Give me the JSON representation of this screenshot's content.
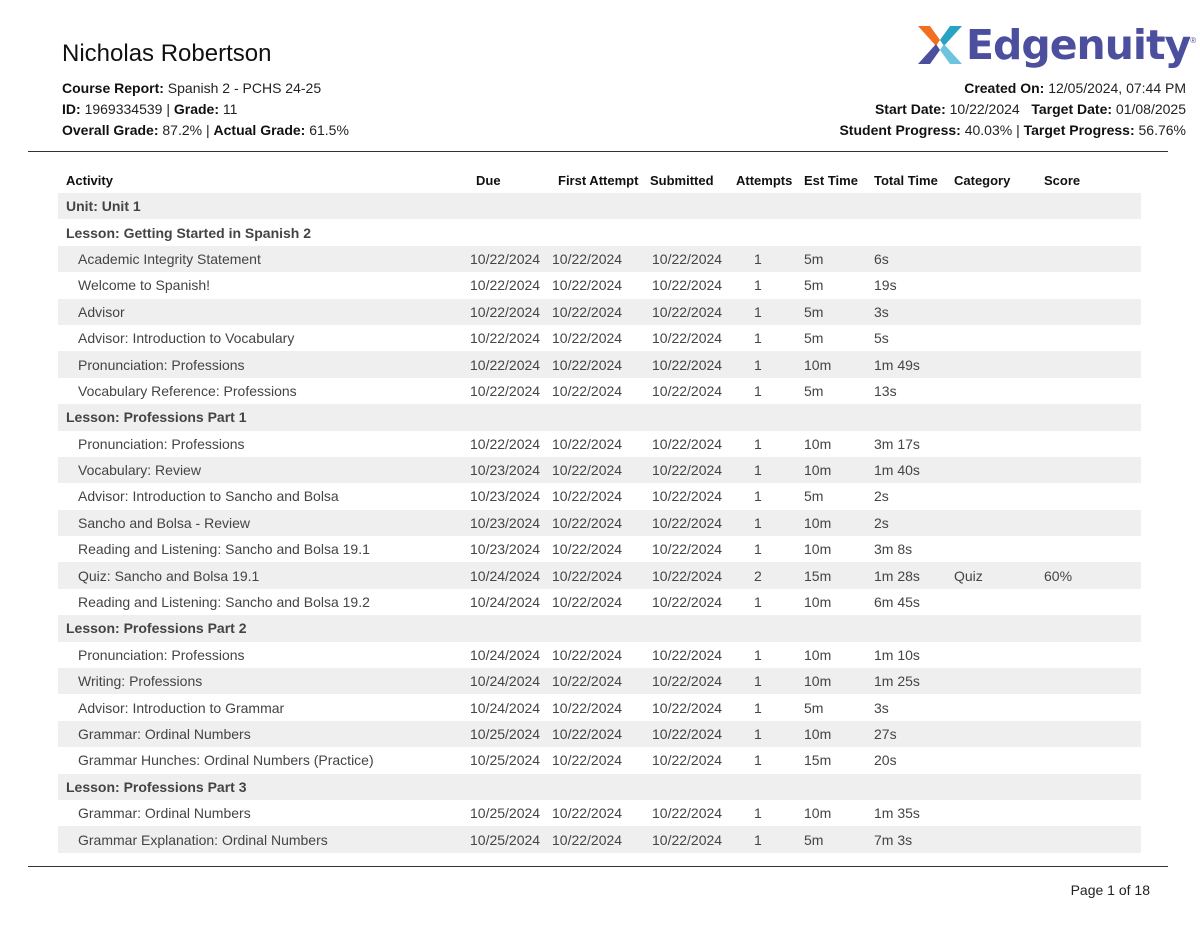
{
  "header": {
    "student_name": "Nicholas Robertson",
    "course_report_label": "Course Report:",
    "course_report_value": "Spanish 2 - PCHS 24-25",
    "id_label": "ID:",
    "id_value": "1969334539",
    "grade_label": "Grade:",
    "grade_value": "11",
    "overall_grade_label": "Overall Grade:",
    "overall_grade_value": "87.2%",
    "actual_grade_label": "Actual Grade:",
    "actual_grade_value": "61.5%",
    "created_on_label": "Created On:",
    "created_on_value": "12/05/2024, 07:44 PM",
    "start_date_label": "Start Date:",
    "start_date_value": "10/22/2024",
    "target_date_label": "Target Date:",
    "target_date_value": "01/08/2025",
    "student_progress_label": "Student Progress:",
    "student_progress_value": "40.03%",
    "target_progress_label": "Target Progress:",
    "target_progress_value": "56.76%",
    "separator": "|"
  },
  "logo": {
    "text": "Edgenuity",
    "reg": "®",
    "colors": {
      "purple": "#4b4f9e",
      "orange": "#f26f21",
      "teal": "#29a3c2",
      "light_blue": "#6cc4de"
    }
  },
  "table": {
    "columns": [
      "Activity",
      "Due",
      "First Attempt",
      "Submitted",
      "Attempts",
      "Est Time",
      "Total Time",
      "Category",
      "Score"
    ],
    "rows": [
      {
        "type": "group",
        "label": "Unit: Unit 1"
      },
      {
        "type": "group",
        "label": "Lesson: Getting Started in Spanish 2"
      },
      {
        "type": "item",
        "cells": [
          "Academic Integrity Statement",
          "10/22/2024",
          "10/22/2024",
          "10/22/2024",
          "1",
          "5m",
          "6s",
          "",
          ""
        ]
      },
      {
        "type": "item",
        "cells": [
          "Welcome to Spanish!",
          "10/22/2024",
          "10/22/2024",
          "10/22/2024",
          "1",
          "5m",
          "19s",
          "",
          ""
        ]
      },
      {
        "type": "item",
        "cells": [
          "Advisor",
          "10/22/2024",
          "10/22/2024",
          "10/22/2024",
          "1",
          "5m",
          "3s",
          "",
          ""
        ]
      },
      {
        "type": "item",
        "cells": [
          "Advisor: Introduction to Vocabulary",
          "10/22/2024",
          "10/22/2024",
          "10/22/2024",
          "1",
          "5m",
          "5s",
          "",
          ""
        ]
      },
      {
        "type": "item",
        "cells": [
          "Pronunciation: Professions",
          "10/22/2024",
          "10/22/2024",
          "10/22/2024",
          "1",
          "10m",
          "1m 49s",
          "",
          ""
        ]
      },
      {
        "type": "item",
        "cells": [
          "Vocabulary Reference: Professions",
          "10/22/2024",
          "10/22/2024",
          "10/22/2024",
          "1",
          "5m",
          "13s",
          "",
          ""
        ]
      },
      {
        "type": "group",
        "label": "Lesson: Professions Part 1"
      },
      {
        "type": "item",
        "cells": [
          "Pronunciation: Professions",
          "10/22/2024",
          "10/22/2024",
          "10/22/2024",
          "1",
          "10m",
          "3m 17s",
          "",
          ""
        ]
      },
      {
        "type": "item",
        "cells": [
          "Vocabulary: Review",
          "10/23/2024",
          "10/22/2024",
          "10/22/2024",
          "1",
          "10m",
          "1m 40s",
          "",
          ""
        ]
      },
      {
        "type": "item",
        "cells": [
          "Advisor: Introduction to Sancho and Bolsa",
          "10/23/2024",
          "10/22/2024",
          "10/22/2024",
          "1",
          "5m",
          "2s",
          "",
          ""
        ]
      },
      {
        "type": "item",
        "cells": [
          "Sancho and Bolsa - Review",
          "10/23/2024",
          "10/22/2024",
          "10/22/2024",
          "1",
          "10m",
          "2s",
          "",
          ""
        ]
      },
      {
        "type": "item",
        "cells": [
          "Reading and Listening: Sancho and Bolsa 19.1",
          "10/23/2024",
          "10/22/2024",
          "10/22/2024",
          "1",
          "10m",
          "3m 8s",
          "",
          ""
        ]
      },
      {
        "type": "item",
        "cells": [
          "Quiz: Sancho and Bolsa 19.1",
          "10/24/2024",
          "10/22/2024",
          "10/22/2024",
          "2",
          "15m",
          "1m 28s",
          "Quiz",
          "60%"
        ]
      },
      {
        "type": "item",
        "cells": [
          "Reading and Listening: Sancho and Bolsa 19.2",
          "10/24/2024",
          "10/22/2024",
          "10/22/2024",
          "1",
          "10m",
          "6m 45s",
          "",
          ""
        ]
      },
      {
        "type": "group",
        "label": "Lesson: Professions Part 2"
      },
      {
        "type": "item",
        "cells": [
          "Pronunciation: Professions",
          "10/24/2024",
          "10/22/2024",
          "10/22/2024",
          "1",
          "10m",
          "1m 10s",
          "",
          ""
        ]
      },
      {
        "type": "item",
        "cells": [
          "Writing: Professions",
          "10/24/2024",
          "10/22/2024",
          "10/22/2024",
          "1",
          "10m",
          "1m 25s",
          "",
          ""
        ]
      },
      {
        "type": "item",
        "cells": [
          "Advisor: Introduction to Grammar",
          "10/24/2024",
          "10/22/2024",
          "10/22/2024",
          "1",
          "5m",
          "3s",
          "",
          ""
        ]
      },
      {
        "type": "item",
        "cells": [
          "Grammar: Ordinal Numbers",
          "10/25/2024",
          "10/22/2024",
          "10/22/2024",
          "1",
          "10m",
          "27s",
          "",
          ""
        ]
      },
      {
        "type": "item",
        "cells": [
          "Grammar Hunches: Ordinal Numbers (Practice)",
          "10/25/2024",
          "10/22/2024",
          "10/22/2024",
          "1",
          "15m",
          "20s",
          "",
          ""
        ]
      },
      {
        "type": "group",
        "label": "Lesson: Professions Part 3"
      },
      {
        "type": "item",
        "cells": [
          "Grammar: Ordinal Numbers",
          "10/25/2024",
          "10/22/2024",
          "10/22/2024",
          "1",
          "10m",
          "1m 35s",
          "",
          ""
        ]
      },
      {
        "type": "item",
        "cells": [
          "Grammar Explanation: Ordinal Numbers",
          "10/25/2024",
          "10/22/2024",
          "10/22/2024",
          "1",
          "5m",
          "7m 3s",
          "",
          ""
        ]
      }
    ]
  },
  "footer": {
    "page_label": "Page 1 of 18"
  }
}
